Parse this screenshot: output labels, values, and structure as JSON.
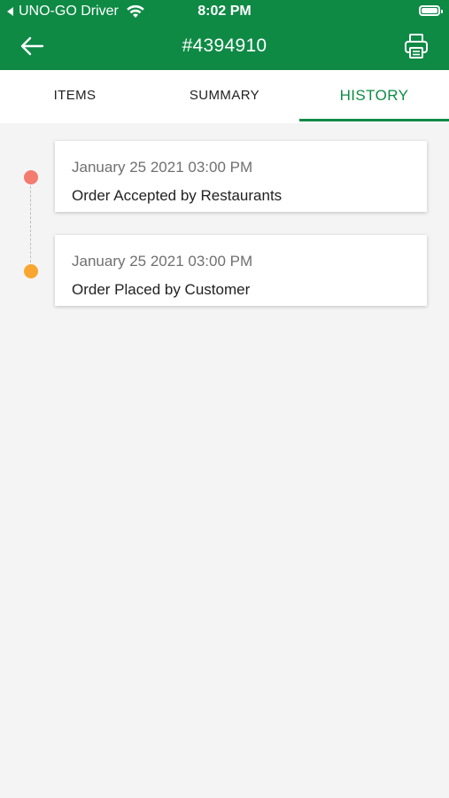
{
  "status_bar": {
    "back_app": "UNO-GO Driver",
    "time": "8:02 PM"
  },
  "header": {
    "order_number": "#4394910"
  },
  "tabs": [
    {
      "label": "ITEMS",
      "active": false
    },
    {
      "label": "SUMMARY",
      "active": false
    },
    {
      "label": "HISTORY",
      "active": true
    }
  ],
  "history": [
    {
      "date": "January 25 2021 03:00 PM",
      "event": "Order Accepted by Restaurants",
      "dot_color": "#f37b6f"
    },
    {
      "date": "January 25 2021 03:00 PM",
      "event": "Order Placed by Customer",
      "dot_color": "#f7a731"
    }
  ],
  "colors": {
    "brand_green": "#0e8a45",
    "background": "#f4f4f4"
  }
}
